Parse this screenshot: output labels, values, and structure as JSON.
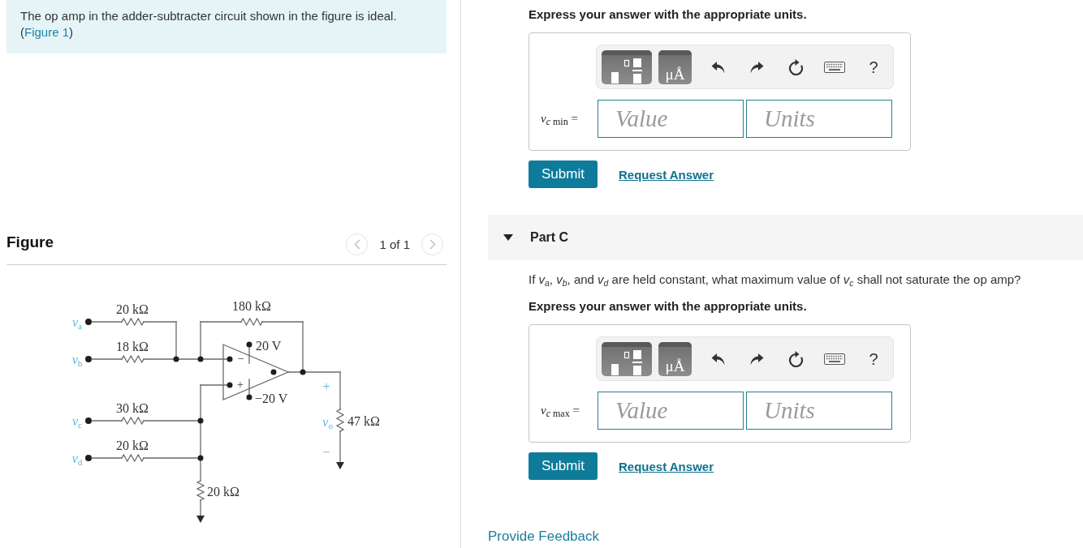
{
  "intro": {
    "text": "The op amp in the adder-subtracter circuit shown in the figure is ideal.",
    "link_before": "(",
    "link": "Figure 1",
    "link_after": ")"
  },
  "figure": {
    "title": "Figure",
    "pager": {
      "prev": {
        "disabled": true
      },
      "position": "1 of 1",
      "next": {
        "disabled": true
      }
    },
    "circuit": {
      "inputs": [
        {
          "label": "*v*$_{a}$",
          "resistor": "20 kΩ"
        },
        {
          "label": "*v*$_{b}$",
          "resistor": "18 kΩ"
        },
        {
          "label": "*v*$_{c}$",
          "resistor": "30 kΩ"
        },
        {
          "label": "*v*$_{d}$",
          "resistor": "20 kΩ"
        }
      ],
      "feedback_resistor": "180 kΩ",
      "supply_positive": "20 V",
      "inverting_sign": "−",
      "noninverting_sign": "+",
      "supply_negative": "−20 V",
      "output": {
        "plus": "+",
        "label": "*v*$_{o}$",
        "load_resistor": "47 kΩ",
        "minus": "−"
      },
      "ground_resistor": "20 kΩ"
    }
  },
  "parts": [
    {
      "instruction": "Express your answer with the appropriate units.",
      "answer": {
        "toolbar": [
          {
            "kind": "templates"
          },
          {
            "kind": "units",
            "label": "μÅ"
          },
          {
            "kind": "undo"
          },
          {
            "kind": "redo"
          },
          {
            "kind": "reset"
          },
          {
            "kind": "keyboard"
          },
          {
            "kind": "help",
            "label": "?"
          }
        ],
        "variable": "*v$_{c}$*$_{ min}$ =",
        "value": {
          "placeholder": "Value"
        },
        "units": {
          "placeholder": "Units"
        }
      },
      "submit": "Submit",
      "request_answer": "Request Answer"
    },
    {
      "title": "Part C",
      "expanded": true,
      "question": "If *v$_{a}$*, *v$_{b}$*, and *v$_{d}$* are held constant, what maximum value of *v$_{c}$* shall not saturate the op amp?",
      "instruction": "Express your answer with the appropriate units.",
      "answer": {
        "toolbar": [
          {
            "kind": "templates"
          },
          {
            "kind": "units",
            "label": "μÅ"
          },
          {
            "kind": "undo"
          },
          {
            "kind": "redo"
          },
          {
            "kind": "reset"
          },
          {
            "kind": "keyboard"
          },
          {
            "kind": "help",
            "label": "?"
          }
        ],
        "variable": "*v$_{c}$*$_{ max}$ =",
        "value": {
          "placeholder": "Value"
        },
        "units": {
          "placeholder": "Units"
        }
      },
      "submit": "Submit",
      "request_answer": "Request Answer"
    }
  ],
  "feedback_link": "Provide Feedback"
}
